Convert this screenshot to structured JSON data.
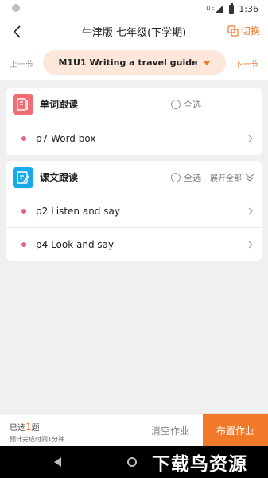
{
  "status": {
    "time": "1:36",
    "network": "LTE"
  },
  "header": {
    "title": "牛津版 七年级(下学期)",
    "switch_label": "切换"
  },
  "section_nav": {
    "prev_label": "上一节",
    "next_label": "下一节",
    "current": "M1U1 Writing a travel guide"
  },
  "word_card": {
    "title": "单词跟读",
    "select_all": "全选",
    "items": [
      {
        "label": "p7 Word box"
      }
    ]
  },
  "text_card": {
    "title": "课文跟读",
    "select_all": "全选",
    "expand_label": "展开全部",
    "items": [
      {
        "label": "p2 Listen and say"
      },
      {
        "label": "p4 Look and say"
      }
    ]
  },
  "footer": {
    "selected_prefix": "已选",
    "selected_count": "1",
    "selected_suffix": "题",
    "eta": "预计完成时间1分钟",
    "clear_label": "清空作业",
    "assign_label": "布置作业"
  },
  "watermark": "下载鸟资源",
  "colors": {
    "accent": "#f2782a",
    "pill_bg": "#fde6da",
    "word_icon": "#f26d72",
    "text_icon": "#18a9e8",
    "bullet": "#e8617a"
  }
}
